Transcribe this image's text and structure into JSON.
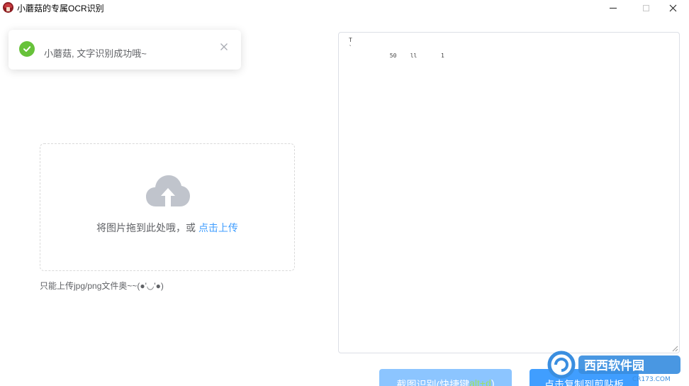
{
  "window": {
    "title": "小蘑菇的专属OCR识别",
    "minimize_label": "—",
    "maximize_label": "□",
    "close_label": "✕"
  },
  "toast": {
    "message": "小蘑菇, 文字识别成功哦~",
    "close_label": "×",
    "icon": "check-circle-icon",
    "color": "#67c23a"
  },
  "upload": {
    "icon": "cloud-upload-icon",
    "prompt": "将图片拖到此处哦，或 ",
    "link": "点击上传",
    "tip": "只能上传jpg/png文件奥~~(●'◡'●)"
  },
  "result": {
    "value": "T\n`\n            50    ll       1"
  },
  "buttons": {
    "capture_prefix": "截图识别(快捷键 ",
    "capture_shortcut": "alt+d",
    "capture_suffix": " )",
    "copy": "点击复制到剪贴板"
  },
  "watermark": {
    "brand": "西西软件园",
    "domain": "CR173.COM"
  },
  "colors": {
    "primary": "#409eff",
    "primary_light": "#8cc5ff",
    "success": "#67c23a",
    "text": "#606266"
  }
}
